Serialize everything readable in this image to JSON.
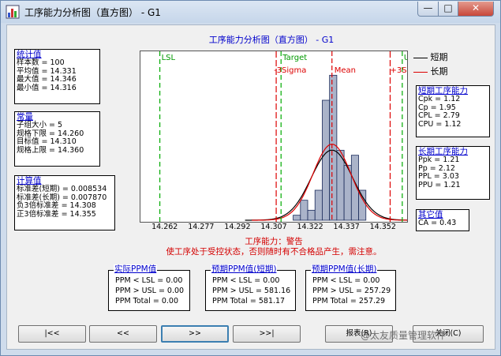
{
  "window": {
    "title": "工序能力分析图（直方图） - G1"
  },
  "titlebar_buttons": {
    "minimize": "—",
    "maximize": "□",
    "close": "✕"
  },
  "chart_title": "工序能力分析图（直方图） - G1",
  "stats": {
    "header": "统计值",
    "rows": [
      "样本数 = 100",
      "平均值 = 14.331",
      "最大值 = 14.346",
      "最小值 = 14.316"
    ]
  },
  "constants": {
    "header": "常量",
    "rows": [
      "子组大小 = 5",
      "规格下限 = 14.260",
      "目标值    = 14.310",
      "规格上限 = 14.360"
    ]
  },
  "calc": {
    "header": "计算值",
    "rows": [
      "标准差(短期) = 0.008534",
      "标准差(长期) = 0.007870",
      "负3倍标准差 = 14.308",
      "正3倍标准差 = 14.355"
    ]
  },
  "short_term": {
    "header": "短期工序能力",
    "rows": [
      "Cpk = 1.12",
      "Cp  = 1.95",
      "CPL = 2.79",
      "CPU = 1.12"
    ]
  },
  "long_term": {
    "header": "长期工序能力",
    "rows": [
      "Ppk = 1.21",
      "Pp  = 2.12",
      "PPL = 3.03",
      "PPU = 1.21"
    ]
  },
  "other": {
    "header": "其它值",
    "rows": [
      "CA = 0.43"
    ]
  },
  "legend": {
    "short": "短期",
    "long": "长期"
  },
  "plot_labels": {
    "lsl": "LSL",
    "target": "Target",
    "usl": "USL",
    "minus3": "-3Sigma",
    "mean": "Mean",
    "plus3": "+3Sigma"
  },
  "x_ticks": [
    "14.262",
    "14.277",
    "14.292",
    "14.307",
    "14.322",
    "14.337",
    "14.352"
  ],
  "warning": {
    "title": "工序能力：警告",
    "message": "使工序处于受控状态，否则随时有不合格品产生，需注意。"
  },
  "ppm_actual": {
    "header": "实际PPM值",
    "rows": [
      "PPM < LSL  =  0.00",
      "PPM > USL  =  0.00",
      "PPM Total   =  0.00"
    ]
  },
  "ppm_short": {
    "header": "预期PPM值(短期)",
    "rows": [
      "PPM < LSL  =  0.00",
      "PPM > USL  =  581.16",
      "PPM Total   =  581.17"
    ]
  },
  "ppm_long": {
    "header": "预期PPM值(长期)",
    "rows": [
      "PPM < LSL  =  0.00",
      "PPM > USL  =  257.29",
      "PPM Total   =  257.29"
    ]
  },
  "nav": {
    "first": "|<<",
    "prev": "<<",
    "next": ">>",
    "last": ">>|",
    "report": "报表(R)",
    "close": "关闭(C)"
  },
  "watermark": "@太友质量管理软件",
  "colors": {
    "short_curve": "#000000",
    "long_curve": "#dd0000",
    "bars": "#aab3c9",
    "spec": "#00aa00"
  },
  "chart_data": {
    "type": "bar",
    "x_range": [
      14.252,
      14.362
    ],
    "bins": [
      {
        "x": 14.3165,
        "count": 1
      },
      {
        "x": 14.3195,
        "count": 4
      },
      {
        "x": 14.3225,
        "count": 2
      },
      {
        "x": 14.3255,
        "count": 6
      },
      {
        "x": 14.3285,
        "count": 24
      },
      {
        "x": 14.3315,
        "count": 29
      },
      {
        "x": 14.3345,
        "count": 14
      },
      {
        "x": 14.3375,
        "count": 11
      },
      {
        "x": 14.3405,
        "count": 13
      },
      {
        "x": 14.3435,
        "count": 6
      }
    ],
    "lsl": 14.26,
    "target": 14.31,
    "usl": 14.36,
    "mean": 14.331,
    "minus3sigma": 14.308,
    "plus3sigma": 14.355,
    "sigma_short": 0.008534,
    "sigma_long": 0.00787
  }
}
